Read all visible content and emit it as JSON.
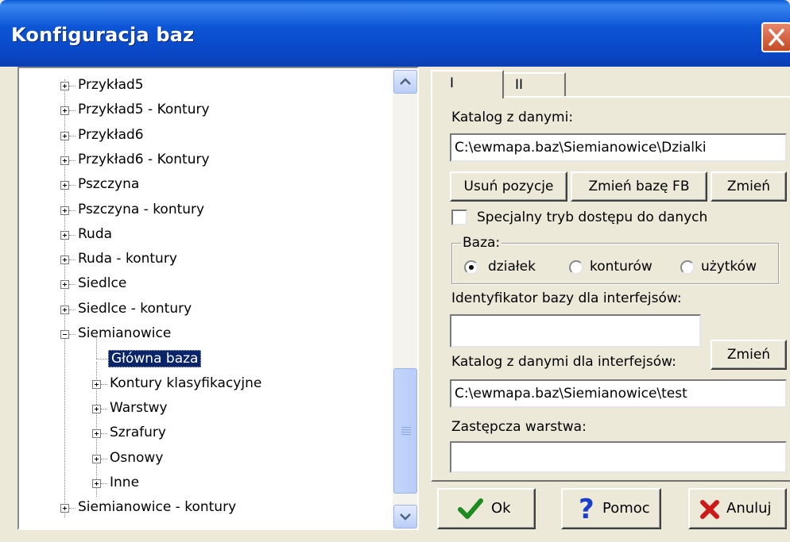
{
  "window": {
    "title": "Konfiguracja baz"
  },
  "tree": {
    "items": [
      {
        "label": "Przykład5",
        "level": 0,
        "expander": "plus"
      },
      {
        "label": "Przykład5 - Kontury",
        "level": 0,
        "expander": "plus"
      },
      {
        "label": "Przykład6",
        "level": 0,
        "expander": "plus"
      },
      {
        "label": "Przykład6 - Kontury",
        "level": 0,
        "expander": "plus"
      },
      {
        "label": "Pszczyna",
        "level": 0,
        "expander": "plus"
      },
      {
        "label": "Pszczyna - kontury",
        "level": 0,
        "expander": "plus"
      },
      {
        "label": "Ruda",
        "level": 0,
        "expander": "plus"
      },
      {
        "label": "Ruda - kontury",
        "level": 0,
        "expander": "plus"
      },
      {
        "label": "Siedlce",
        "level": 0,
        "expander": "plus"
      },
      {
        "label": "Siedlce - kontury",
        "level": 0,
        "expander": "plus"
      },
      {
        "label": "Siemianowice",
        "level": 0,
        "expander": "minus"
      },
      {
        "label": "Główna baza",
        "level": 1,
        "expander": "none",
        "selected": true
      },
      {
        "label": "Kontury klasyfikacyjne",
        "level": 1,
        "expander": "plus"
      },
      {
        "label": "Warstwy",
        "level": 1,
        "expander": "plus"
      },
      {
        "label": "Szrafury",
        "level": 1,
        "expander": "plus"
      },
      {
        "label": "Osnowy",
        "level": 1,
        "expander": "plus"
      },
      {
        "label": "Inne",
        "level": 1,
        "expander": "plus"
      },
      {
        "label": "Siemianowice - kontury",
        "level": 0,
        "expander": "plus"
      }
    ]
  },
  "tabs": [
    {
      "label": "I",
      "active": true
    },
    {
      "label": "II",
      "active": false
    }
  ],
  "form": {
    "data_dir_label": "Katalog z danymi:",
    "data_dir_value": "C:\\ewmapa.baz\\Siemianowice\\Dzialki",
    "btn_remove": "Usuń pozycje",
    "btn_change_fb": "Zmień bazę FB",
    "btn_change": "Zmień",
    "special_mode_label": "Specjalny tryb dostępu do danych",
    "special_mode_checked": false,
    "base_group_label": "Baza:",
    "base_options": [
      {
        "label": "działek",
        "selected": true
      },
      {
        "label": "konturów",
        "selected": false
      },
      {
        "label": "użytków",
        "selected": false
      }
    ],
    "iface_id_label": "Identyfikator bazy dla interfejsów:",
    "iface_id_value": "",
    "iface_dir_label": "Katalog z danymi dla interfejsów:",
    "iface_dir_button": "Zmień",
    "iface_dir_value": "C:\\ewmapa.baz\\Siemianowice\\test",
    "subst_layer_label": "Zastępcza warstwa:",
    "subst_layer_value": ""
  },
  "buttons": {
    "ok": "Ok",
    "help": "Pomoc",
    "cancel": "Anuluj"
  },
  "icons": {
    "ok": "checkmark-icon",
    "help": "question-mark-icon",
    "cancel": "x-cross-icon",
    "close": "close-icon"
  },
  "colors": {
    "title_bar": "#0a55d6",
    "selection": "#0a246a",
    "close_button": "#d9562f",
    "ok_icon": "#1f8a1f",
    "help_icon": "#1a3fcc",
    "cancel_icon": "#cc1a1a"
  }
}
